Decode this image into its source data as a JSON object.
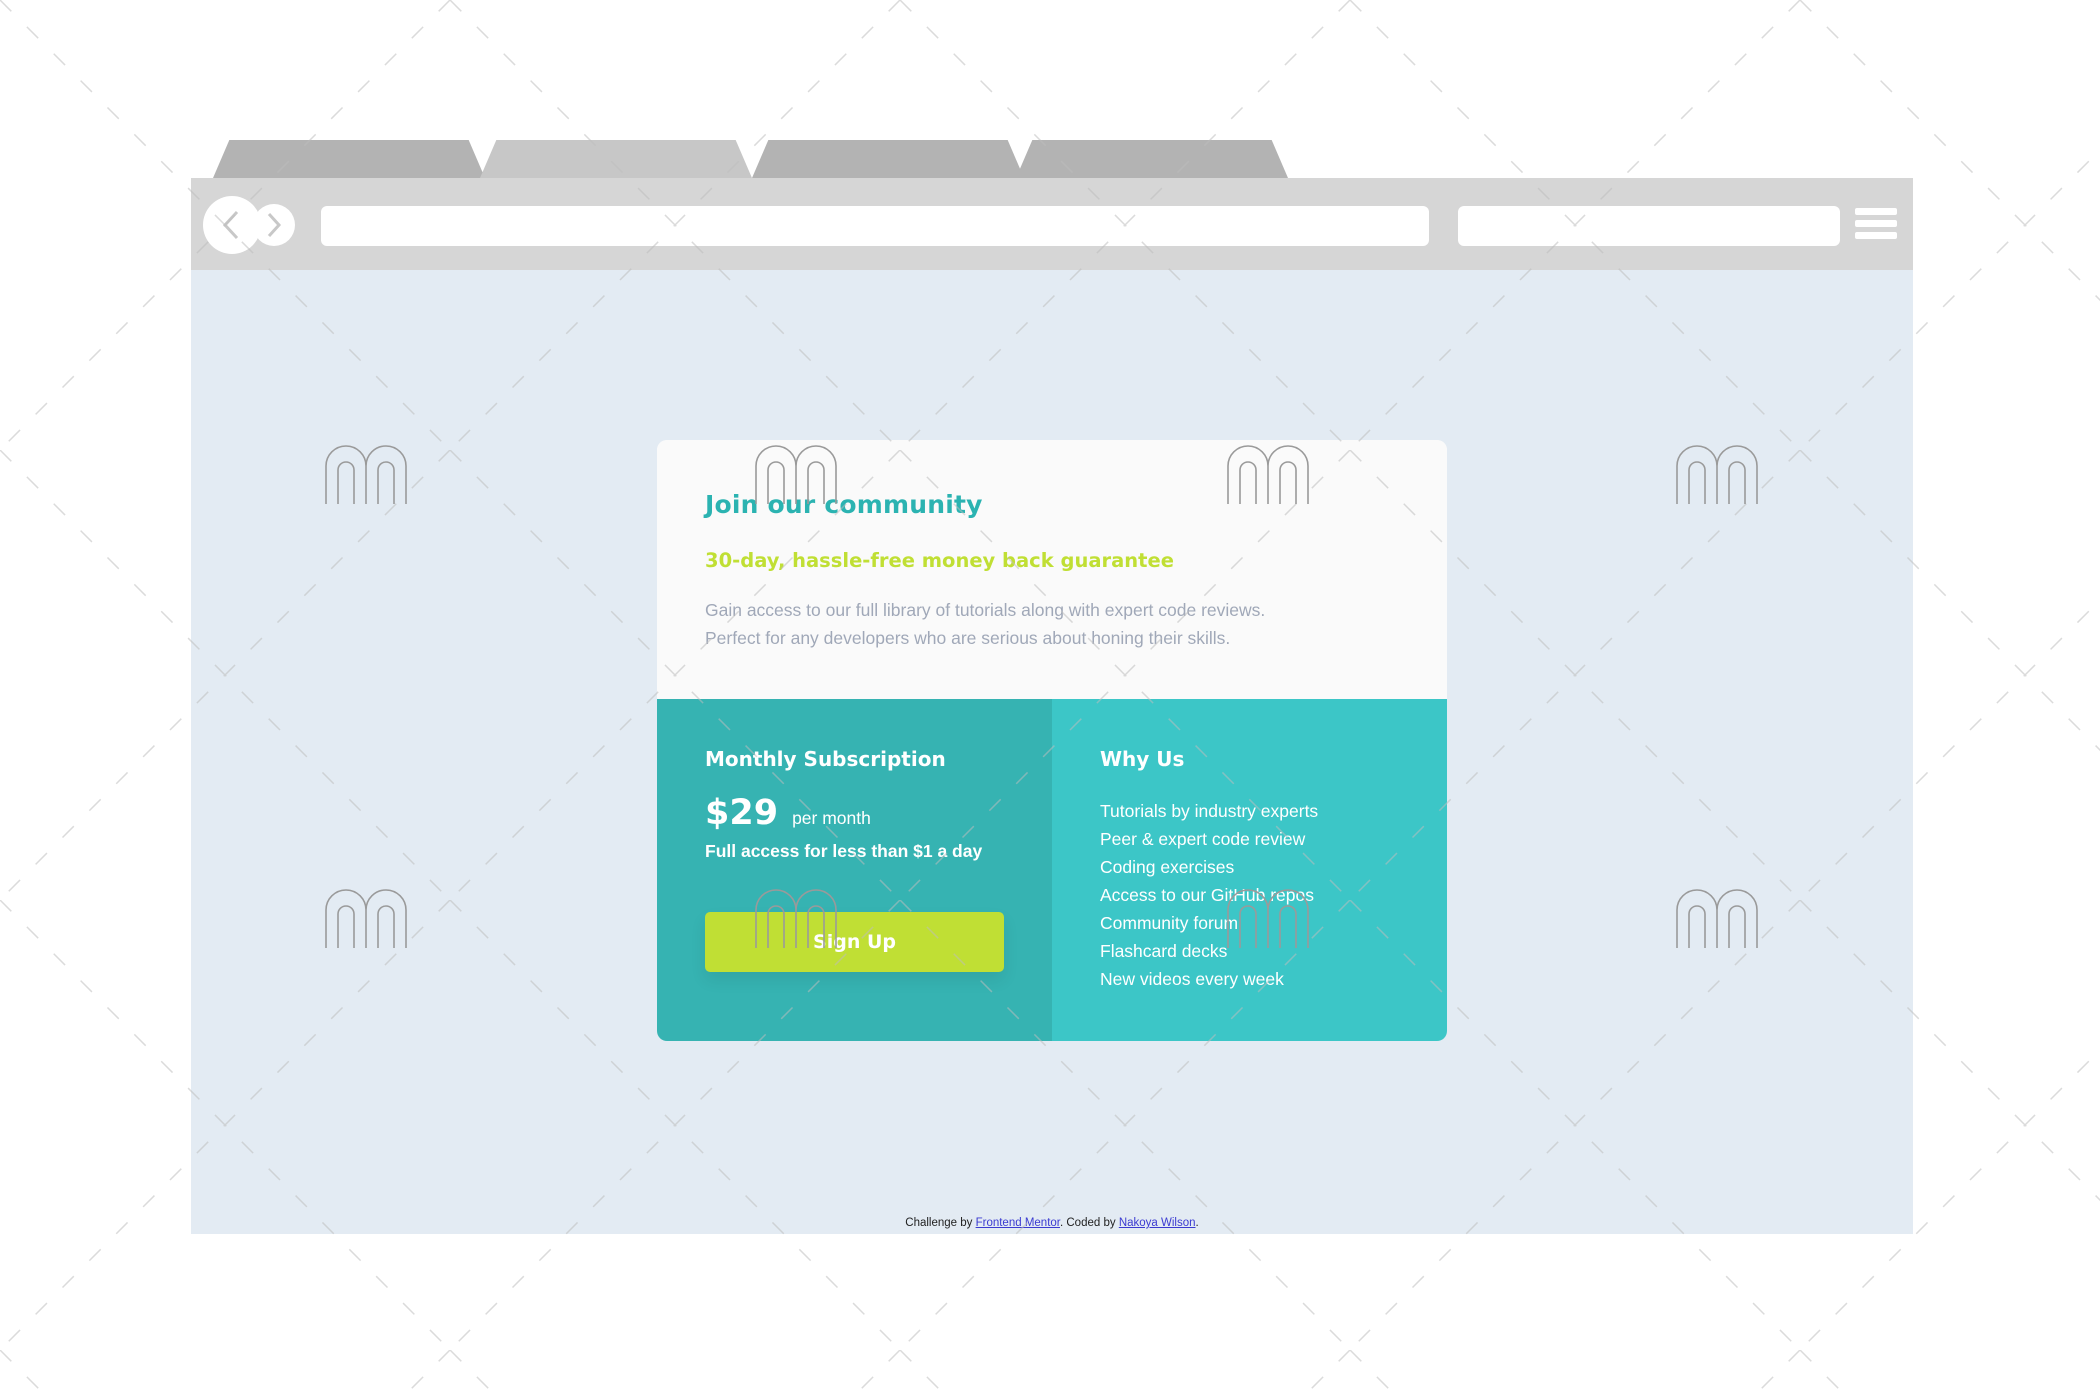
{
  "browser": {
    "tabs": [
      "",
      "",
      "",
      ""
    ]
  },
  "card": {
    "title": "Join our community",
    "guarantee": "30-day, hassle-free money back guarantee",
    "description_line1": "Gain access to our full library of tutorials along with expert code reviews.",
    "description_line2": "Perfect for any developers who are serious about honing their skills."
  },
  "subscription": {
    "heading": "Monthly Subscription",
    "price": "$29",
    "period": "per month",
    "note": "Full access for less than $1 a day",
    "button_label": "Sign Up"
  },
  "why": {
    "heading": "Why Us",
    "items": [
      "Tutorials by industry experts",
      "Peer & expert code review",
      "Coding exercises",
      "Access to our GitHub repos",
      "Community forum",
      "Flashcard decks",
      "New videos every week"
    ]
  },
  "attribution": {
    "prefix": "Challenge by ",
    "link1": "Frontend Mentor",
    "middle": ". Coded by ",
    "link2": "Nakoya Wilson",
    "suffix": "."
  },
  "colors": {
    "accent_teal": "#2bb3b1",
    "accent_lime": "#c0df34",
    "panel_left": "#36b3b2",
    "panel_right": "#3cc6c7",
    "page_bg": "#e3ebf3"
  }
}
